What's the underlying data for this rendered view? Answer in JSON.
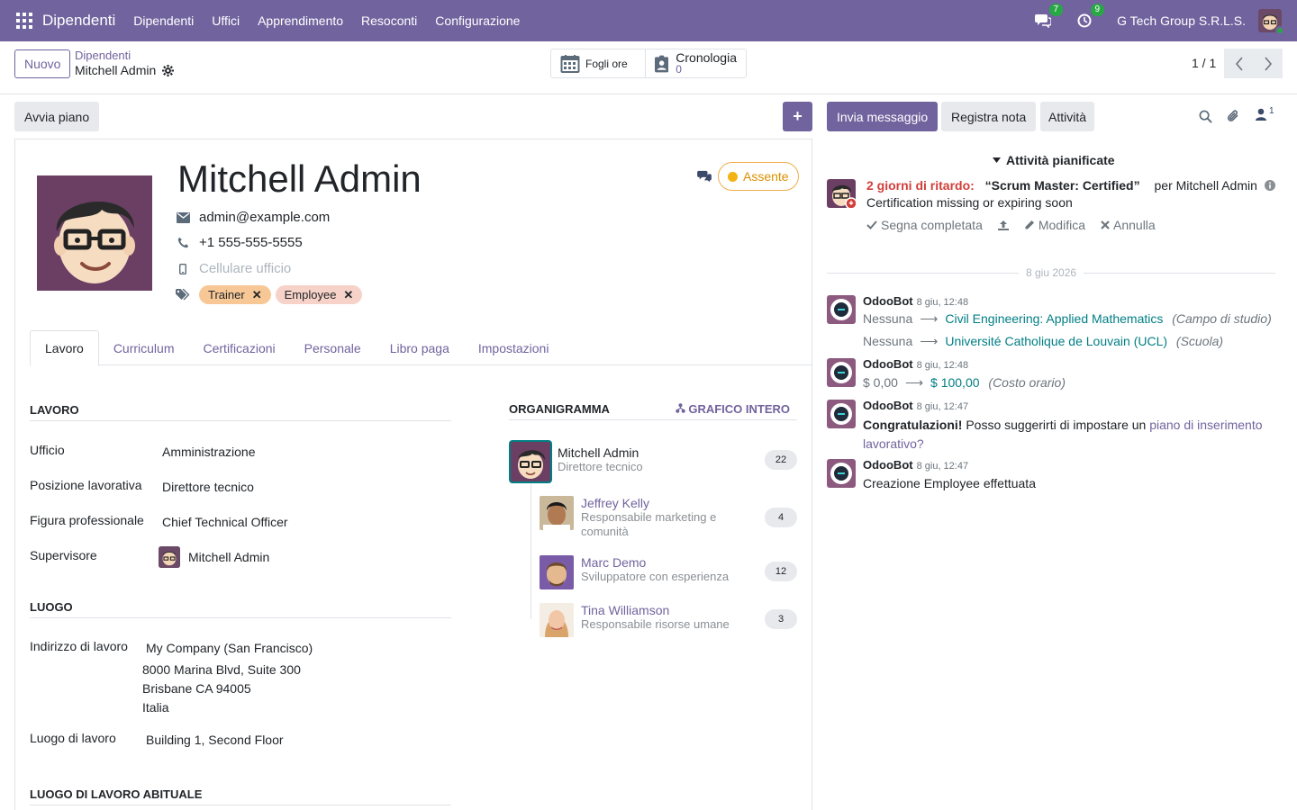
{
  "navbar": {
    "brand": "Dipendenti",
    "menu": [
      "Dipendenti",
      "Uffici",
      "Apprendimento",
      "Resoconti",
      "Configurazione"
    ],
    "messages_count": "7",
    "activities_count": "9",
    "company": "G Tech Group S.R.L.S."
  },
  "control": {
    "new_label": "Nuovo",
    "breadcrumb_parent": "Dipendenti",
    "breadcrumb_current": "Mitchell Admin",
    "timesheets_label": "Fogli ore",
    "history_label": "Cronologia",
    "history_count": "0",
    "pager": "1 / 1"
  },
  "statusbar": {
    "plan_label": "Avvia piano",
    "plus_label": "+"
  },
  "employee": {
    "name": "Mitchell Admin",
    "email": "admin@example.com",
    "phone": "+1 555-555-5555",
    "mobile_placeholder": "Cellulare ufficio",
    "tags": [
      "Trainer",
      "Employee"
    ],
    "status": "Assente"
  },
  "tabs": [
    "Lavoro",
    "Curriculum",
    "Certificazioni",
    "Personale",
    "Libro paga",
    "Impostazioni"
  ],
  "work": {
    "section_work": "LAVORO",
    "fields": [
      {
        "label": "Ufficio",
        "value": "Amministrazione"
      },
      {
        "label": "Posizione lavorativa",
        "value": "Direttore tecnico"
      },
      {
        "label": "Figura professionale",
        "value": "Chief Technical Officer"
      },
      {
        "label": "Supervisore",
        "value": "Mitchell Admin"
      }
    ],
    "section_location": "LUOGO",
    "address_label": "Indirizzo di lavoro",
    "address_lines": [
      "My Company (San Francisco)",
      "8000 Marina Blvd, Suite 300",
      "Brisbane CA 94005",
      "Italia"
    ],
    "place_label": "Luogo di lavoro",
    "place_value": "Building 1, Second Floor",
    "section_habitual": "LUOGO DI LAVORO ABITUALE"
  },
  "org": {
    "title": "ORGANIGRAMMA",
    "full_chart": "GRAFICO INTERO",
    "main": {
      "name": "Mitchell Admin",
      "role": "Direttore tecnico",
      "count": "22"
    },
    "subs": [
      {
        "name": "Jeffrey Kelly",
        "role": "Responsabile marketing e comunità",
        "count": "4"
      },
      {
        "name": "Marc Demo",
        "role": "Sviluppatore con esperienza",
        "count": "12"
      },
      {
        "name": "Tina Williamson",
        "role": "Responsabile risorse umane",
        "count": "3"
      }
    ]
  },
  "chatter": {
    "send_label": "Invia messaggio",
    "note_label": "Registra nota",
    "activity_label": "Attività",
    "followers_count": "1",
    "planned_header": "Attività pianificate",
    "activity": {
      "late": "2 giorni di ritardo:",
      "summary": "“Scrum Master: Certified”",
      "for": "per Mitchell Admin",
      "note": "Certification missing or expiring soon",
      "mark_done": "Segna completata",
      "edit": "Modifica",
      "cancel": "Annulla"
    },
    "date_separator": "8 giu 2026",
    "messages": [
      {
        "author": "OdooBot",
        "date": "8 giu, 12:48"
      },
      {
        "author": "OdooBot",
        "date": "8 giu, 12:48"
      },
      {
        "author": "OdooBot",
        "date": "8 giu, 12:47"
      },
      {
        "author": "OdooBot",
        "date": "8 giu, 12:47"
      }
    ],
    "m1": {
      "old1": "Nessuna",
      "new1": "Civil Engineering: Applied Mathematics",
      "field1": "(Campo di studio)",
      "old2": "Nessuna",
      "new2": "Université Catholique de Louvain (UCL)",
      "field2": "(Scuola)"
    },
    "m2": {
      "old": "$ 0,00",
      "new": "$ 100,00",
      "field": "(Costo orario)"
    },
    "m3": {
      "bold": "Congratulazioni!",
      "text": " Posso suggerirti di impostare un ",
      "link1": "piano di inserimento",
      "link2": "lavorativo?"
    },
    "m4": {
      "text": "Creazione Employee effettuata"
    }
  },
  "colors": {
    "brand": "#71639e",
    "late": "#d23f3a",
    "teal": "#017e84",
    "absent": "#f3b314",
    "tag_trainer": "#f7c896",
    "tag_employee": "#f6d2c8"
  }
}
